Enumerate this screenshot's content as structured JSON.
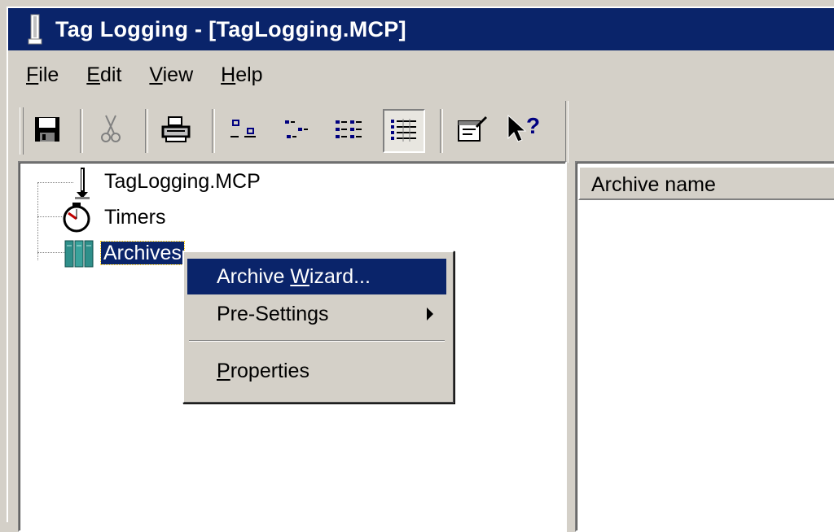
{
  "window": {
    "title": "Tag Logging - [TagLogging.MCP]"
  },
  "menubar": {
    "items": [
      {
        "accel": "F",
        "rest": "ile"
      },
      {
        "accel": "E",
        "rest": "dit"
      },
      {
        "accel": "V",
        "rest": "iew"
      },
      {
        "accel": "H",
        "rest": "elp"
      }
    ]
  },
  "toolbar": {
    "buttons": [
      "save-icon",
      "cut-icon",
      "print-icon",
      "large-icons-icon",
      "small-icons-icon",
      "list-icon",
      "details-icon",
      "properties-icon",
      "help-pointer-icon"
    ],
    "pressed": "details-icon"
  },
  "tree": {
    "root": "TagLogging.MCP",
    "timers": "Timers",
    "archives": "Archives"
  },
  "list": {
    "column_header": "Archive name"
  },
  "context_menu": {
    "wizard_pre": "Archive ",
    "wizard_accel": "W",
    "wizard_post": "izard...",
    "presettings": "Pre-Settings",
    "properties_accel": "P",
    "properties_rest": "roperties"
  },
  "colors": {
    "titlebar": "#0a246a",
    "face": "#d4d0c8",
    "highlight": "#0a246a"
  }
}
